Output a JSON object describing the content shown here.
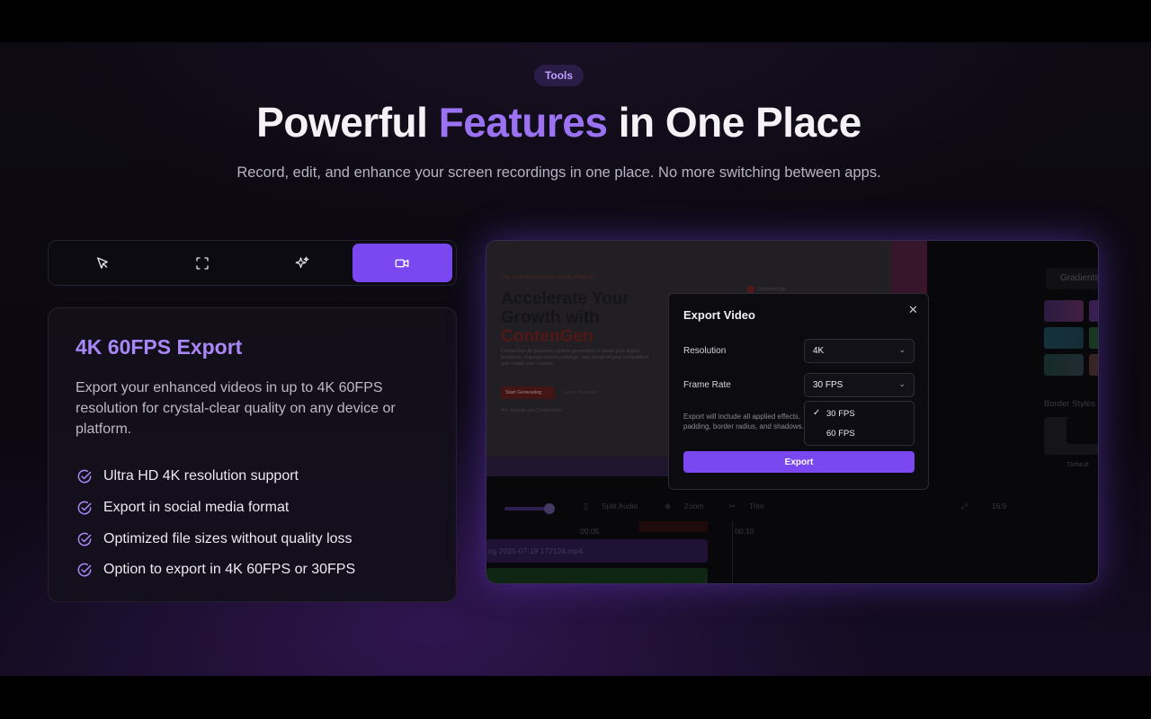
{
  "section": {
    "badge": "Tools",
    "title_part1": "Powerful ",
    "title_accent": "Features",
    "title_part2": " in One Place",
    "subtitle": "Record, edit, and enhance your screen recordings in one place. No more switching between apps."
  },
  "tabs": [
    {
      "icon": "cursor-icon",
      "active": false
    },
    {
      "icon": "focus-frame-icon",
      "active": false
    },
    {
      "icon": "sparkles-icon",
      "active": false
    },
    {
      "icon": "video-camera-icon",
      "active": true
    }
  ],
  "feature": {
    "title": "4K 60FPS Export",
    "description": "Export your enhanced videos in up to 4K 60FPS resolution for crystal-clear quality on any device or platform.",
    "items": [
      "Ultra HD 4K resolution support",
      "Export in social media format",
      "Optimized file sizes without quality loss",
      "Option to export in 4K 60FPS or 30FPS"
    ]
  },
  "preview": {
    "canvas": {
      "tagline": "The Smartest Content Growth Platform",
      "headline_line1": "Accelerate Your",
      "headline_line2": "Growth with",
      "headline_brand": "ContenGen",
      "paragraph": "ContenGen AI-powered content generation to boost your digital presence. Improve search rankings, stay ahead of your competitors, and create your content.",
      "btn_primary": "Start Generating",
      "btn_secondary": "Learn Features",
      "avatars_text": "40+ brands use ContenGen",
      "logo_text": "ContenGen"
    },
    "side": {
      "gradients_label": "Gradients",
      "border_label": "Border Styles",
      "default_label": "Default"
    },
    "toolbar": {
      "split_audio": "Split Audio",
      "zoom": "Zoom",
      "trim": "Trim",
      "ratio": "16:9"
    },
    "timeline": {
      "t1": "00:05",
      "t2": "00:10",
      "clip_name": "ng 2025-07-19 172124.mp4"
    }
  },
  "modal": {
    "title": "Export Video",
    "resolution_label": "Resolution",
    "resolution_value": "4K",
    "framerate_label": "Frame Rate",
    "framerate_value": "30 FPS",
    "note": "Export will include all applied effects, padding, border radius, and shadows.",
    "options": [
      "30 FPS",
      "60 FPS"
    ],
    "selected_option": "30 FPS",
    "export_label": "Export"
  },
  "colors": {
    "accent": "#7b47f0",
    "accent_text": "#9b73f2",
    "background": "#0d0a13"
  }
}
